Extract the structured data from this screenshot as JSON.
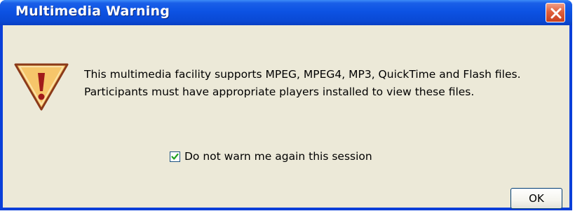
{
  "window": {
    "title": "Multimedia Warning"
  },
  "icons": {
    "warning": "warning-triangle-icon",
    "close": "close-icon",
    "checkmark": "checkmark-icon"
  },
  "message": {
    "line1": "This multimedia facility supports MPEG, MPEG4, MP3, QuickTime and Flash files.",
    "line2": "Participants must have appropriate players installed to view these files."
  },
  "checkbox": {
    "label": "Do not warn me again this session",
    "checked": true
  },
  "buttons": {
    "ok_label": "OK"
  },
  "colors": {
    "titlebar": "#0c52e3",
    "dialog_bg": "#ece9d8",
    "close_button": "#e0603c",
    "warning_fill": "#f6c56a",
    "warning_mark": "#a11a1a"
  }
}
